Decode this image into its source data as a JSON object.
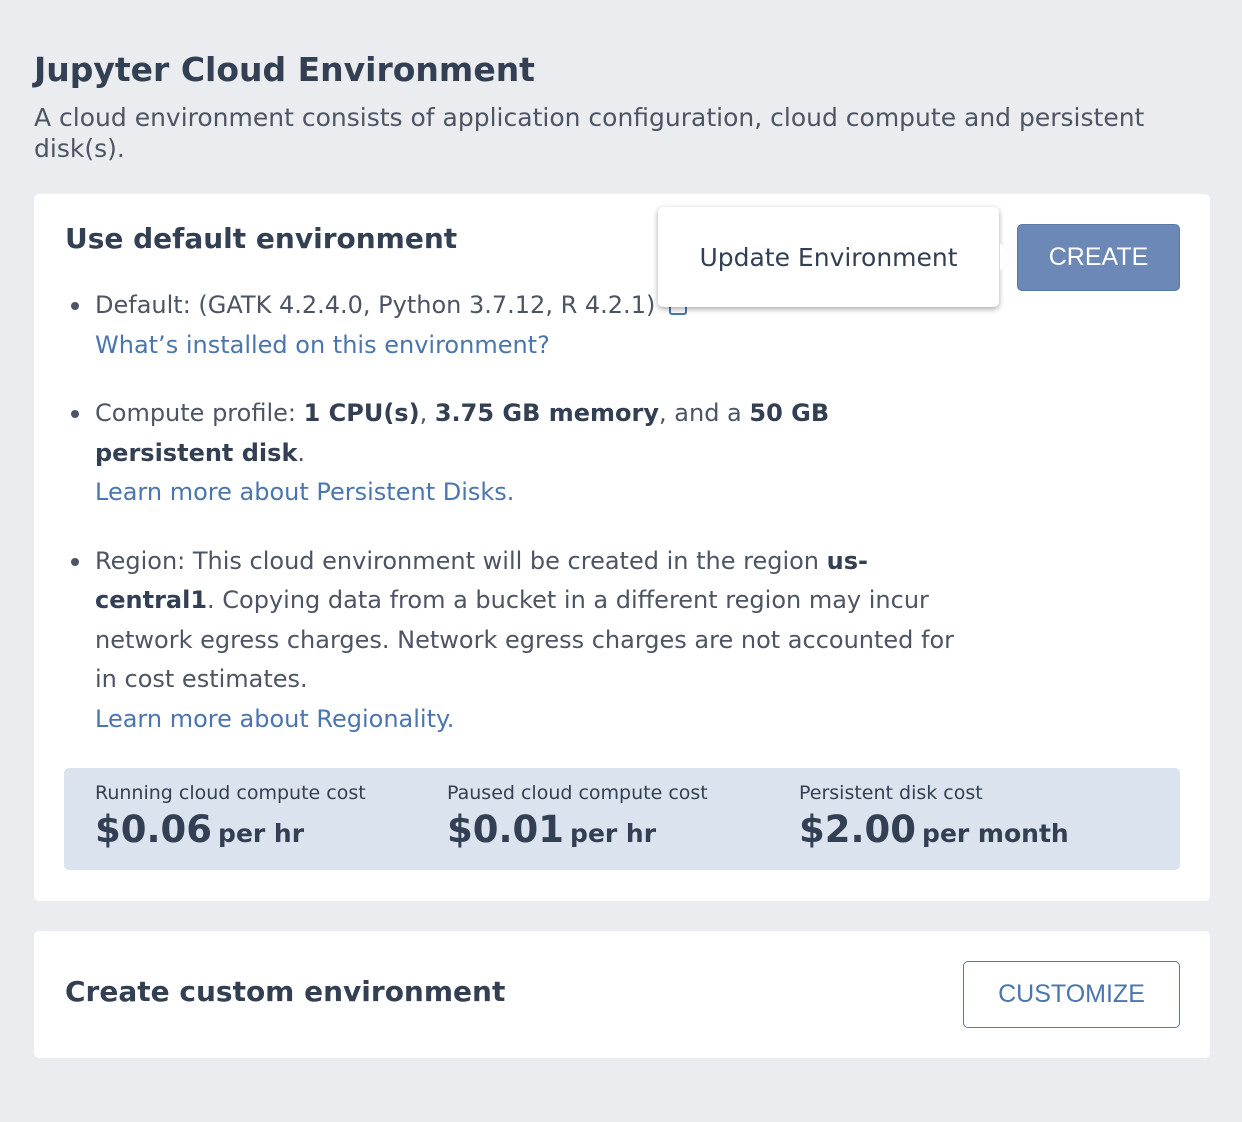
{
  "header": {
    "title": "Jupyter Cloud Environment",
    "description": "A cloud environment consists of application configuration, cloud compute and persistent disk(s)."
  },
  "default_env": {
    "title": "Use default environment",
    "create_label": "CREATE",
    "tooltip": "Update Environment",
    "default_prefix": "Default: ",
    "default_value": "(GATK 4.2.4.0, Python 3.7.12, R 4.2.1)",
    "installed_link": "What’s installed on this environment?",
    "compute_prefix": "Compute profile: ",
    "cpu": "1 CPU(s)",
    "sep1": ", ",
    "memory": "3.75 GB memory",
    "sep2": ", and a ",
    "disk": "50 GB persistent disk",
    "period": ".",
    "disks_link": "Learn more about Persistent Disks.",
    "region_prefix": "Region: This cloud environment will be created in the region ",
    "region": "us-central1",
    "region_suffix": ". Copying data from a bucket in a different region may incur network egress charges. Network egress charges are not accounted for in cost estimates.",
    "region_link": "Learn more about Regionality."
  },
  "costs": [
    {
      "label": "Running cloud compute cost",
      "amount": "$0.06",
      "unit": "per hr"
    },
    {
      "label": "Paused cloud compute cost",
      "amount": "$0.01",
      "unit": "per hr"
    },
    {
      "label": "Persistent disk cost",
      "amount": "$2.00",
      "unit": "per month"
    }
  ],
  "custom_env": {
    "title": "Create custom environment",
    "customize_label": "CUSTOMIZE"
  },
  "colors": {
    "background": "#eaecef",
    "link": "#4b75ae",
    "create_button": "#6b88b6",
    "cost_panel": "#dbe3ee"
  }
}
